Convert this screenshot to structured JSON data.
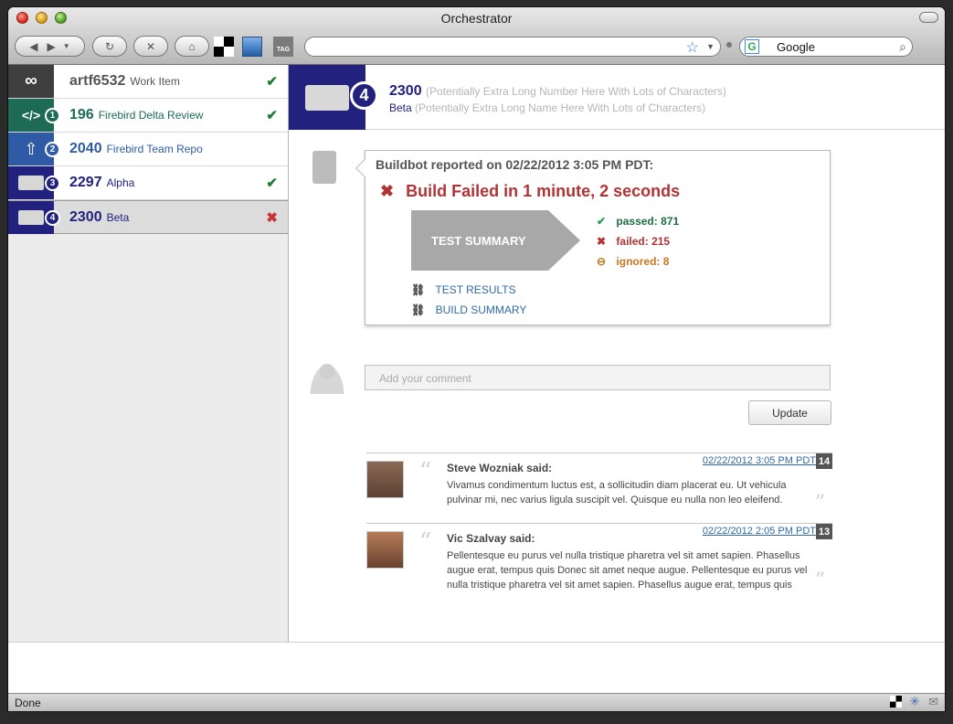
{
  "window": {
    "title": "Orchestrator"
  },
  "search": {
    "value": "Google"
  },
  "sidebar": {
    "items": [
      {
        "id": "artf6532",
        "label": "Work Item",
        "color": "#5a5a5a",
        "status": "✔",
        "status_color": "#1f7d37"
      },
      {
        "id": "196",
        "label": "Firebird Delta Review",
        "badge": "1",
        "color": "#1d6b55",
        "status": "✔",
        "status_color": "#1f7d37"
      },
      {
        "id": "2040",
        "label": "Firebird Team Repo",
        "badge": "2",
        "color": "#2e5aa6",
        "status": ""
      },
      {
        "id": "2297",
        "label": "Alpha",
        "badge": "3",
        "color": "#22217e",
        "status": "✔",
        "status_color": "#1f7d37"
      },
      {
        "id": "2300",
        "label": "Beta",
        "badge": "4",
        "color": "#22217e",
        "status": "✖",
        "status_color": "#cc3333"
      }
    ]
  },
  "header": {
    "badge": "4",
    "number": "2300",
    "number_note": "(Potentially Extra Long Number Here With Lots of Characters)",
    "name": "Beta",
    "name_note": "(Potentially Extra Long Name Here With Lots of Characters)"
  },
  "build": {
    "reported": "Buildbot reported on 02/22/2012 3:05 PM PDT:",
    "failed_title": "Build Failed in 1 minute, 2 seconds",
    "summary_label": "TEST SUMMARY",
    "passed": "passed: 871",
    "failed": "failed: 215",
    "ignored": "ignored: 8",
    "link_results": "TEST RESULTS",
    "link_summary": "BUILD SUMMARY"
  },
  "comment_input": {
    "placeholder": "Add your comment"
  },
  "update_label": "Update",
  "comments": [
    {
      "author": "Steve Wozniak said:",
      "date": "02/22/2012 3:05 PM PDT",
      "number": "14",
      "text": "Vivamus condimentum luctus est, a sollicitudin diam placerat eu. Ut vehicula pulvinar mi, nec varius ligula suscipit vel. Quisque eu nulla non leo eleifend."
    },
    {
      "author": "Vic Szalvay said:",
      "date": "02/22/2012 2:05 PM PDT",
      "number": "13",
      "text": "Pellentesque eu purus vel nulla tristique pharetra vel sit amet sapien. Phasellus augue erat, tempus quis Donec sit amet neque augue. Pellentesque eu purus vel nulla tristique pharetra vel sit amet sapien. Phasellus augue erat, tempus quis"
    }
  ],
  "statusbar": {
    "text": "Done"
  }
}
